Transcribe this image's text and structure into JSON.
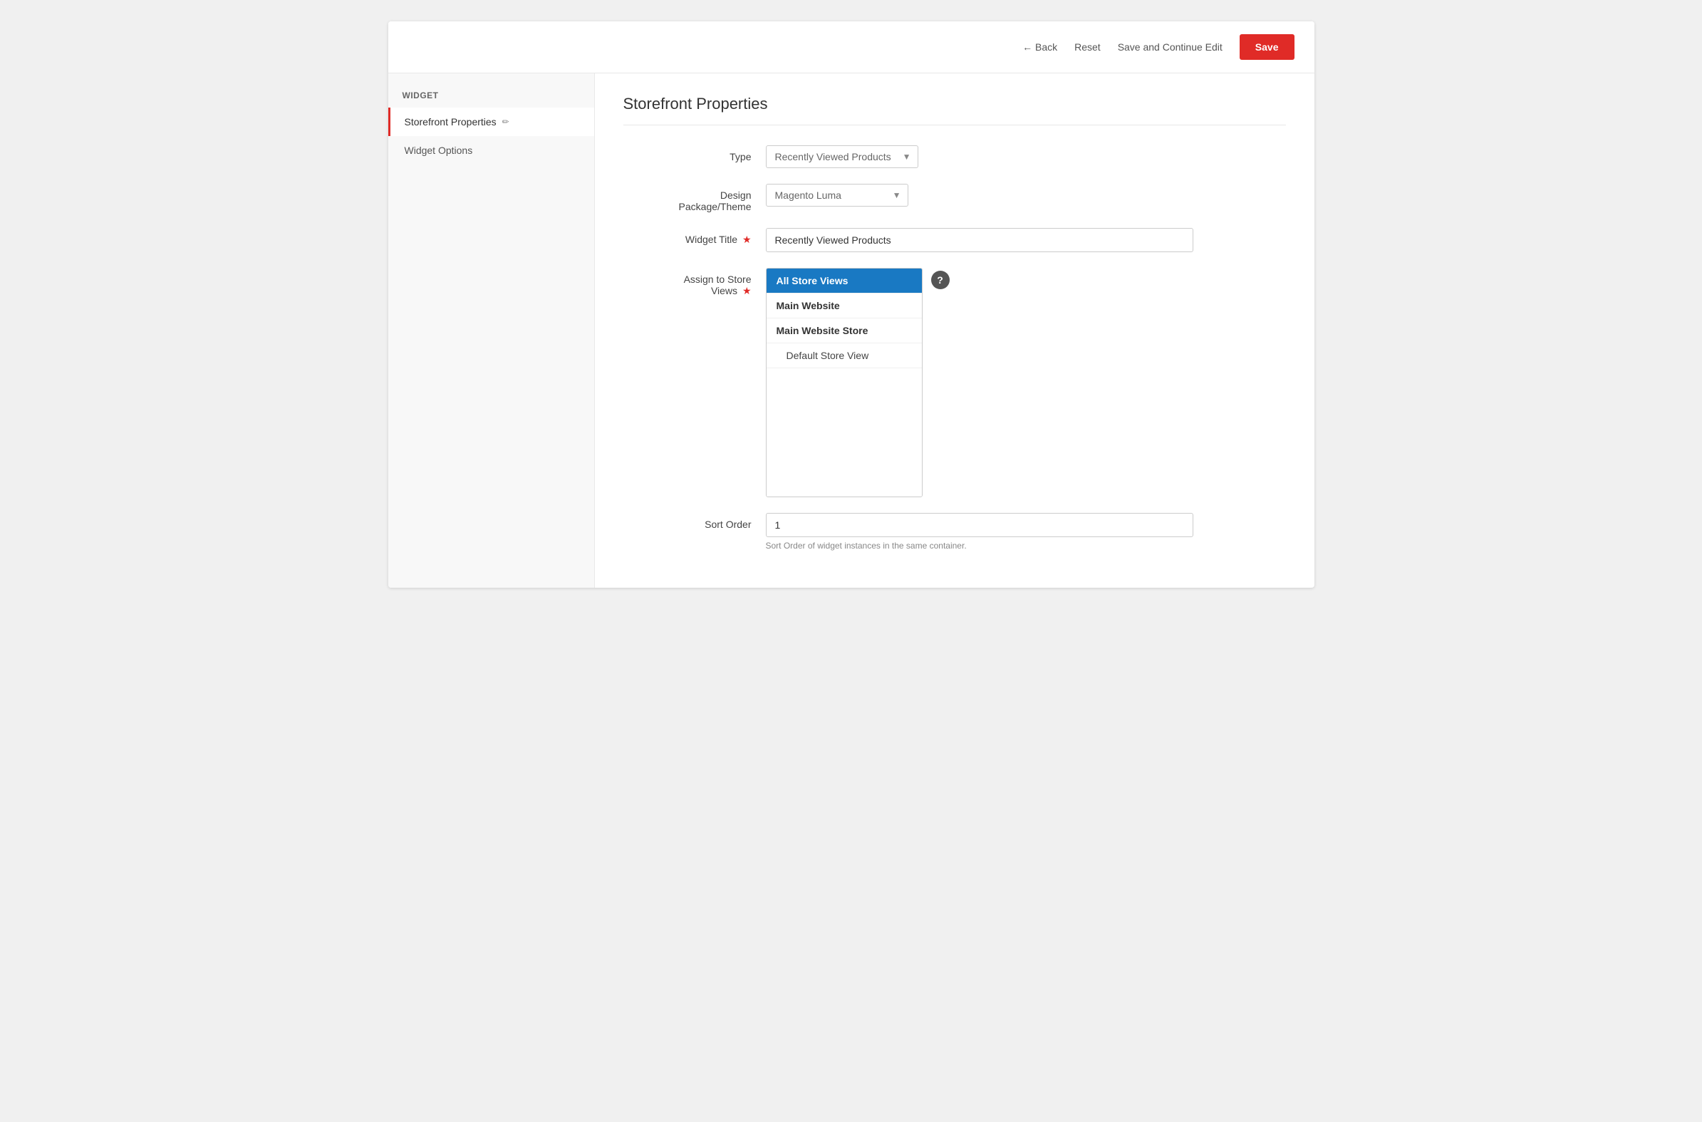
{
  "toolbar": {
    "back_label": "← Back",
    "reset_label": "Reset",
    "save_continue_label": "Save and Continue Edit",
    "save_label": "Save"
  },
  "sidebar": {
    "section_title": "WIDGET",
    "items": [
      {
        "id": "storefront-properties",
        "label": "Storefront Properties",
        "active": true,
        "edit": true
      },
      {
        "id": "widget-options",
        "label": "Widget Options",
        "active": false,
        "edit": false
      }
    ]
  },
  "content": {
    "section_title": "Storefront Properties",
    "fields": {
      "type_label": "Type",
      "type_value": "Recently Viewed Products",
      "design_label": "Design Package/Theme",
      "design_value": "Magento Luma",
      "widget_title_label": "Widget Title",
      "widget_title_value": "Recently Viewed Products",
      "assign_label": "Assign to Store Views",
      "sort_order_label": "Sort Order",
      "sort_order_value": "1",
      "sort_order_hint": "Sort Order of widget instances in the same container."
    },
    "store_views": [
      {
        "id": "all",
        "label": "All Store Views",
        "selected": true,
        "type": "top"
      },
      {
        "id": "main-website",
        "label": "Main Website",
        "selected": false,
        "type": "group-header"
      },
      {
        "id": "main-website-store",
        "label": "Main Website Store",
        "selected": false,
        "type": "group-header"
      },
      {
        "id": "default-store-view",
        "label": "Default Store View",
        "selected": false,
        "type": "sub-item"
      }
    ],
    "help_icon_label": "?"
  }
}
